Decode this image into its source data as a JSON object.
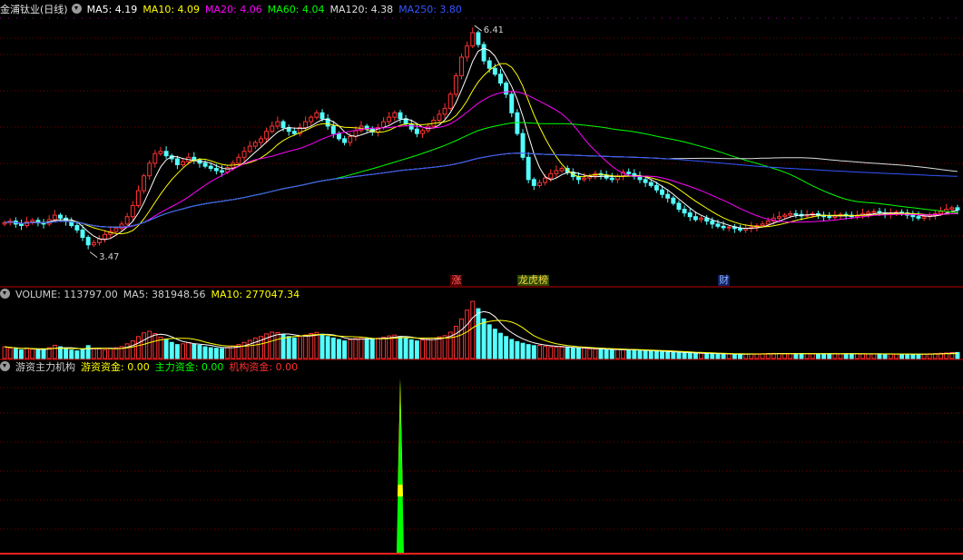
{
  "chart_data": {
    "type": "candlestick",
    "title": "金浦钛业(日线)",
    "ma_legend": [
      {
        "label": "MA5: 4.19",
        "color": "#ffffff"
      },
      {
        "label": "MA10: 4.09",
        "color": "#ffff00"
      },
      {
        "label": "MA20: 4.06",
        "color": "#ff00ff"
      },
      {
        "label": "MA60: 4.04",
        "color": "#00ff00"
      },
      {
        "label": "MA120: 4.38",
        "color": "#dcdcdc"
      },
      {
        "label": "MA250: 3.80",
        "color": "#3355ff"
      }
    ],
    "price_ylim": [
      3.15,
      6.6
    ],
    "high_label": "6.41",
    "low_label": "3.47",
    "high_index": 84,
    "low_index": 15,
    "event_marks": [
      {
        "index": 81,
        "text": "涨",
        "color": "#ff6060",
        "bg": "#5a0000"
      },
      {
        "index": 93,
        "text": "龙虎榜",
        "color": "#ffd24a",
        "bg": "#2a4a00"
      },
      {
        "index": 129,
        "text": "财",
        "color": "#8fb4ff",
        "bg": "#102060"
      }
    ],
    "volume_legend": [
      {
        "label": "VOLUME: 113797.00",
        "color": "#d0d0d0"
      },
      {
        "label": "MA5: 381948.56",
        "color": "#d0d0d0"
      },
      {
        "label": "MA10: 277047.34",
        "color": "#ffff00"
      }
    ],
    "indicator_legend": [
      {
        "label": "游资主力机构",
        "color": "#d0d0d0"
      },
      {
        "label": "游资资金: 0.00",
        "color": "#ffff00"
      },
      {
        "label": "主力资金: 0.00",
        "color": "#00ff00"
      },
      {
        "label": "机构资金: 0.00",
        "color": "#ff3030"
      }
    ],
    "indicator_spike_index": 71,
    "close": [
      3.82,
      3.84,
      3.8,
      3.78,
      3.83,
      3.85,
      3.82,
      3.8,
      3.86,
      3.92,
      3.88,
      3.84,
      3.78,
      3.72,
      3.62,
      3.52,
      3.55,
      3.6,
      3.66,
      3.7,
      3.74,
      3.8,
      3.9,
      4.05,
      4.25,
      4.45,
      4.62,
      4.75,
      4.78,
      4.72,
      4.68,
      4.6,
      4.64,
      4.7,
      4.66,
      4.62,
      4.58,
      4.55,
      4.52,
      4.5,
      4.56,
      4.62,
      4.7,
      4.78,
      4.85,
      4.9,
      4.95,
      5.05,
      5.12,
      5.18,
      5.1,
      5.05,
      5.02,
      5.1,
      5.18,
      5.24,
      5.3,
      5.22,
      5.12,
      5.02,
      4.95,
      4.9,
      4.98,
      5.06,
      5.12,
      5.08,
      5.04,
      5.1,
      5.18,
      5.24,
      5.3,
      5.22,
      5.15,
      5.08,
      5.02,
      5.06,
      5.12,
      5.2,
      5.28,
      5.36,
      5.55,
      5.8,
      6.05,
      6.2,
      6.38,
      6.22,
      6.0,
      5.9,
      5.82,
      5.7,
      5.55,
      5.3,
      5.02,
      4.7,
      4.4,
      4.32,
      4.36,
      4.42,
      4.48,
      4.52,
      4.55,
      4.5,
      4.44,
      4.4,
      4.42,
      4.45,
      4.48,
      4.46,
      4.42,
      4.4,
      4.45,
      4.5,
      4.48,
      4.44,
      4.4,
      4.36,
      4.32,
      4.26,
      4.2,
      4.15,
      4.08,
      4.0,
      3.95,
      3.9,
      3.86,
      3.88,
      3.84,
      3.8,
      3.77,
      3.75,
      3.76,
      3.74,
      3.72,
      3.74,
      3.76,
      3.78,
      3.8,
      3.84,
      3.88,
      3.9,
      3.92,
      3.94,
      3.93,
      3.91,
      3.92,
      3.94,
      3.92,
      3.9,
      3.89,
      3.91,
      3.93,
      3.92,
      3.9,
      3.92,
      3.94,
      3.96,
      3.97,
      3.95,
      3.93,
      3.94,
      3.96,
      3.95,
      3.92,
      3.9,
      3.88,
      3.9,
      3.92,
      3.94,
      3.97,
      4.0,
      4.02,
      3.99
    ],
    "volume": [
      80,
      72,
      66,
      58,
      70,
      64,
      60,
      58,
      74,
      90,
      80,
      66,
      58,
      52,
      66,
      88,
      70,
      66,
      60,
      68,
      74,
      82,
      100,
      120,
      150,
      175,
      186,
      170,
      146,
      128,
      110,
      95,
      100,
      108,
      96,
      90,
      80,
      74,
      70,
      68,
      76,
      84,
      96,
      110,
      124,
      140,
      150,
      168,
      180,
      176,
      162,
      150,
      140,
      150,
      160,
      170,
      178,
      166,
      150,
      140,
      130,
      120,
      128,
      136,
      142,
      136,
      130,
      138,
      146,
      154,
      160,
      150,
      138,
      128,
      120,
      126,
      132,
      140,
      148,
      156,
      180,
      220,
      270,
      330,
      390,
      340,
      270,
      230,
      200,
      172,
      150,
      130,
      115,
      104,
      95,
      88,
      90,
      84,
      80,
      76,
      78,
      74,
      72,
      68,
      70,
      66,
      64,
      62,
      60,
      58,
      62,
      60,
      58,
      56,
      54,
      52,
      50,
      48,
      46,
      44,
      42,
      40,
      38,
      36,
      34,
      36,
      34,
      32,
      30,
      30,
      31,
      30,
      29,
      30,
      31,
      32,
      33,
      34,
      35,
      34,
      33,
      32,
      33,
      34,
      33,
      32,
      31,
      32,
      33,
      32,
      31,
      32,
      33,
      32,
      31,
      30,
      31,
      32,
      31,
      30,
      29,
      30,
      31,
      30,
      29,
      30,
      32,
      34,
      36,
      38,
      40,
      41
    ]
  },
  "colors": {
    "up": "#ff3232",
    "down": "#54ffff",
    "grid": "#7a0000",
    "axis": "#c00000"
  }
}
